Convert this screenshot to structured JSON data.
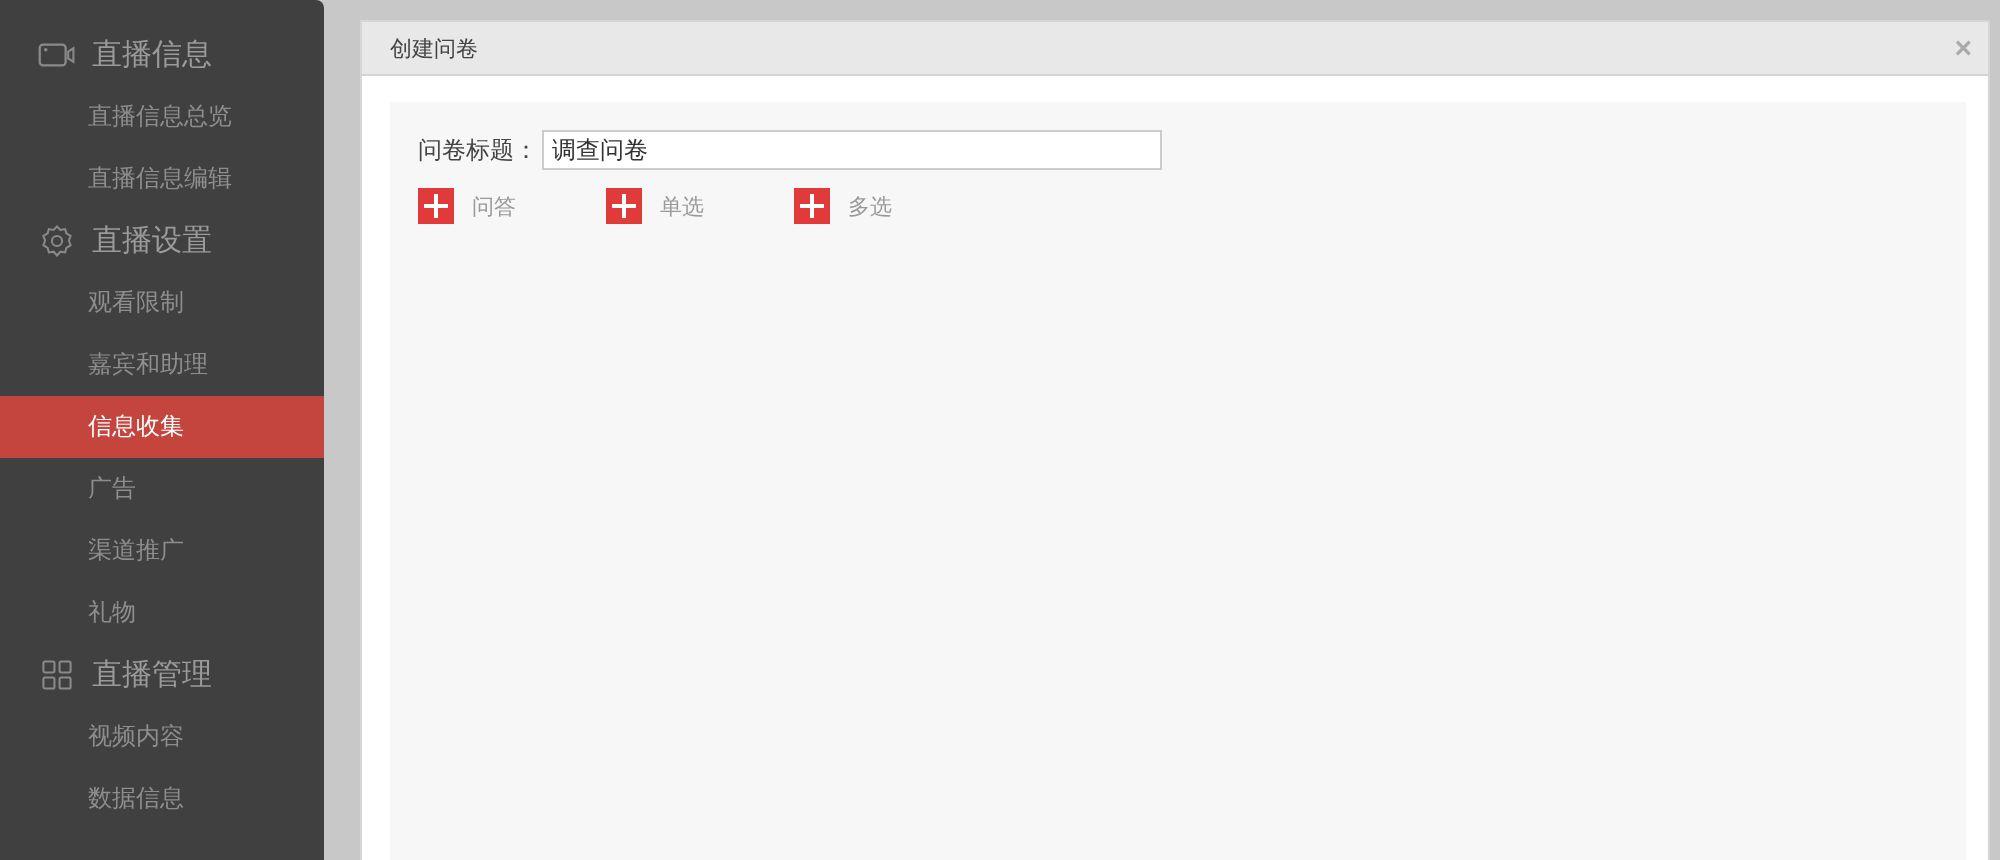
{
  "sidebar": {
    "groups": [
      {
        "label": "直播信息",
        "items": [
          {
            "label": "直播信息总览",
            "selected": false
          },
          {
            "label": "直播信息编辑",
            "selected": false
          }
        ]
      },
      {
        "label": "直播设置",
        "items": [
          {
            "label": "观看限制",
            "selected": false
          },
          {
            "label": "嘉宾和助理",
            "selected": false
          },
          {
            "label": "信息收集",
            "selected": true
          },
          {
            "label": "广告",
            "selected": false
          },
          {
            "label": "渠道推广",
            "selected": false
          },
          {
            "label": "礼物",
            "selected": false
          }
        ]
      },
      {
        "label": "直播管理",
        "items": [
          {
            "label": "视频内容",
            "selected": false
          },
          {
            "label": "数据信息",
            "selected": false
          }
        ]
      }
    ]
  },
  "dialog": {
    "title": "创建问卷",
    "close": "×",
    "title_field": {
      "label": "问卷标题：",
      "value": "调查问卷"
    },
    "add_buttons": [
      {
        "label": "问答"
      },
      {
        "label": "单选"
      },
      {
        "label": "多选"
      }
    ]
  }
}
